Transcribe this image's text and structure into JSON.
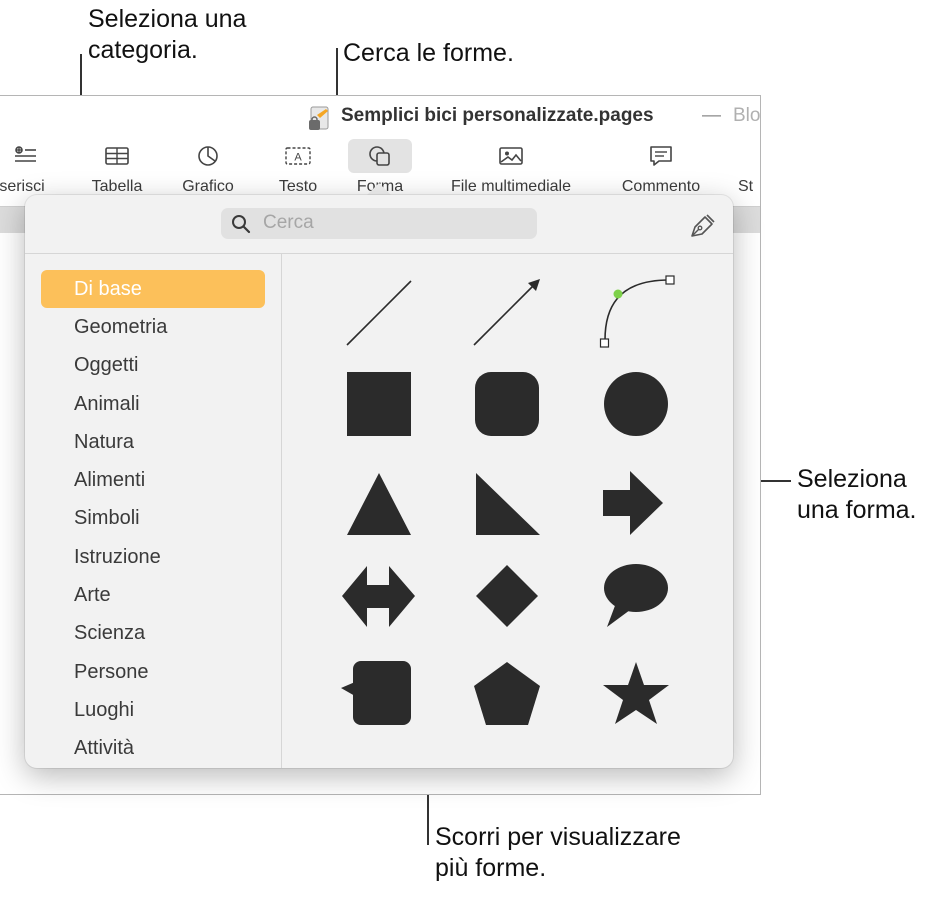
{
  "callouts": {
    "category": [
      "Seleziona una",
      "categoria."
    ],
    "search": "Cerca le forme.",
    "shape": [
      "Seleziona",
      "una forma."
    ],
    "scroll": [
      "Scorri per visualizzare",
      "più forme."
    ]
  },
  "window": {
    "title": "Semplici bici personalizzate.pages",
    "title_separator": "—",
    "title_rest": "Blo"
  },
  "toolbar": {
    "insert": "serisci",
    "table": "Tabella",
    "chart": "Grafico",
    "text": "Testo",
    "shape": "Forma",
    "media": "File multimediale",
    "comment": "Commento",
    "share": "St"
  },
  "popover": {
    "search_placeholder": "Cerca",
    "categories": [
      "Di base",
      "Geometria",
      "Oggetti",
      "Animali",
      "Natura",
      "Alimenti",
      "Simboli",
      "Istruzione",
      "Arte",
      "Scienza",
      "Persone",
      "Luoghi",
      "Attività"
    ],
    "selected_category": "Di base"
  },
  "colors": {
    "selected_category_bg": "#fcc05a",
    "shape_fill": "#2b2b2b",
    "curve_point": "#7ed14a"
  }
}
